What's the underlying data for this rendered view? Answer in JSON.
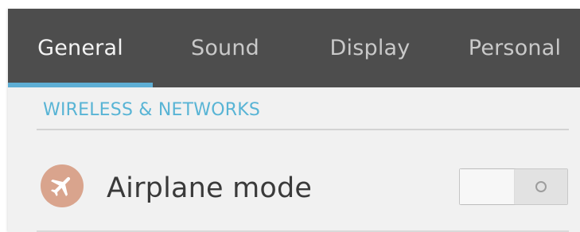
{
  "tabs": [
    {
      "label": "General",
      "active": true
    },
    {
      "label": "Sound",
      "active": false
    },
    {
      "label": "Display",
      "active": false
    },
    {
      "label": "Personal",
      "active": false
    }
  ],
  "section": {
    "header": "WIRELESS & NETWORKS"
  },
  "settings": [
    {
      "label": "Airplane mode",
      "icon": "airplane-icon",
      "toggle_state": "off"
    }
  ],
  "colors": {
    "tab_bar_bg": "#4d4d4d",
    "active_tab_indicator": "#5eaed4",
    "section_header": "#58b4d5",
    "airplane_icon_bg": "#d9a48d",
    "content_bg": "#f1f1f1"
  }
}
